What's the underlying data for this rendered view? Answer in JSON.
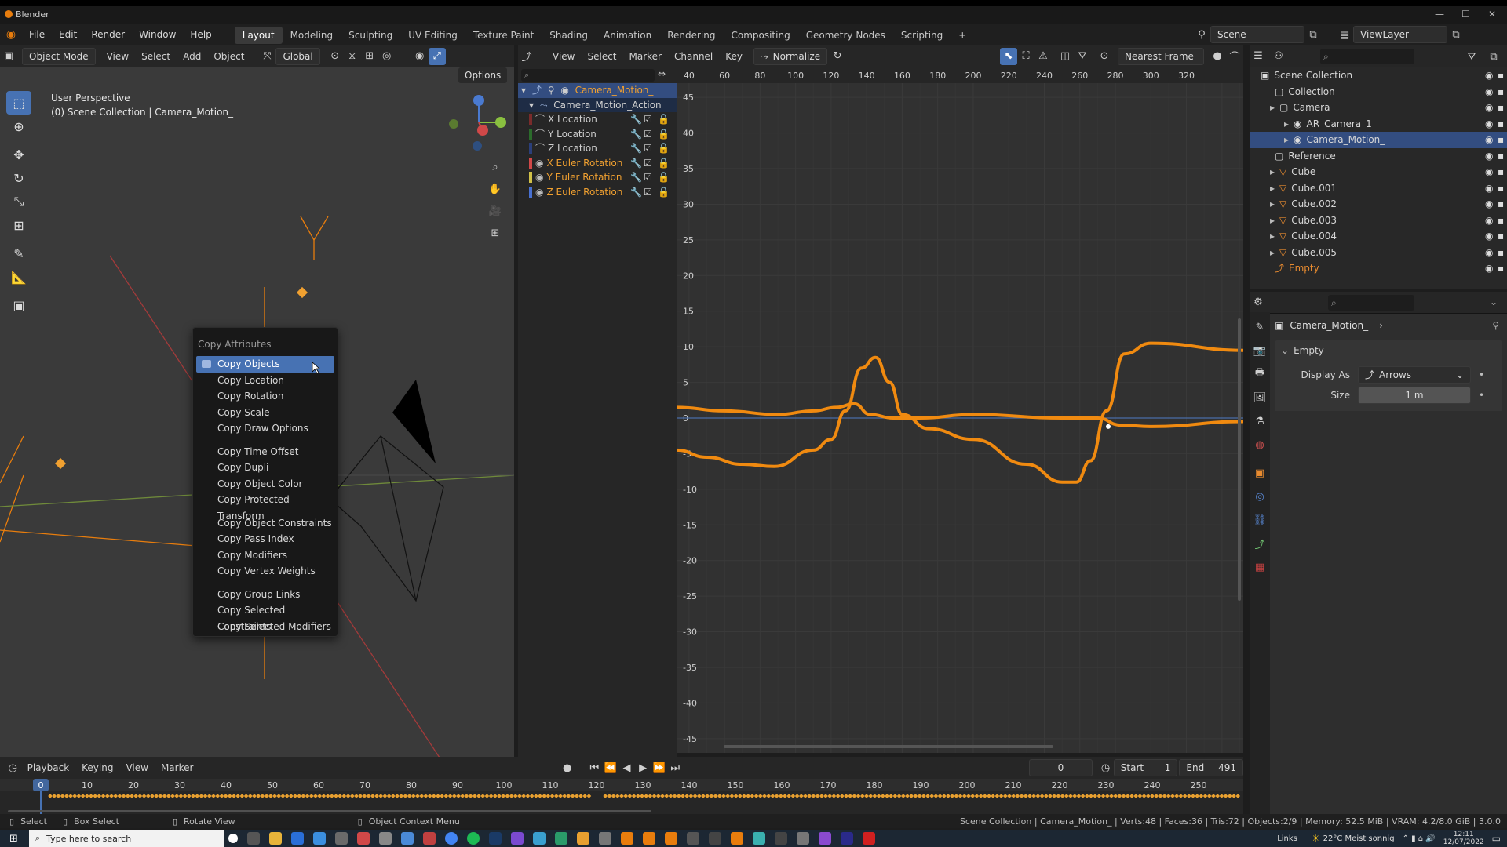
{
  "window": {
    "title": "Blender"
  },
  "menu": [
    "File",
    "Edit",
    "Render",
    "Window",
    "Help"
  ],
  "workspaces": [
    "Layout",
    "Modeling",
    "Sculpting",
    "UV Editing",
    "Texture Paint",
    "Shading",
    "Animation",
    "Rendering",
    "Compositing",
    "Geometry Nodes",
    "Scripting"
  ],
  "workspace_add": "+",
  "scene": {
    "name": "Scene",
    "view_layer": "ViewLayer"
  },
  "viewport": {
    "mode": "Object Mode",
    "menus": [
      "View",
      "Select",
      "Add",
      "Object"
    ],
    "orientation": "Global",
    "options_label": "Options",
    "perspective": "User Perspective",
    "collection_label": "(0) Scene Collection | Camera_Motion_"
  },
  "context_menu": {
    "title": "Copy Attributes",
    "groups": [
      [
        "Copy Objects",
        "Copy Location",
        "Copy Rotation",
        "Copy Scale",
        "Copy Draw Options"
      ],
      [
        "Copy Time Offset",
        "Copy Dupli",
        "Copy Object Color",
        "Copy Protected Transform"
      ],
      [
        "Copy Object Constraints",
        "Copy Pass Index",
        "Copy Modifiers",
        "Copy Vertex Weights"
      ],
      [
        "Copy Group Links",
        "Copy Selected Constraints",
        "Copy Selected Modifiers"
      ]
    ],
    "highlighted": "Copy Objects"
  },
  "graph_editor": {
    "menus": [
      "View",
      "Select",
      "Marker",
      "Channel",
      "Key"
    ],
    "normalize_label": "Normalize",
    "snap_mode": "Nearest Frame",
    "object_channel": "Camera_Motion_",
    "action_channel": "Camera_Motion_Action",
    "channels": [
      {
        "name": "X Location",
        "color": "#7a2b2b",
        "visible": false
      },
      {
        "name": "Y Location",
        "color": "#2b6b2b",
        "visible": false
      },
      {
        "name": "Z Location",
        "color": "#2b3f7a",
        "visible": false
      },
      {
        "name": "X Euler Rotation",
        "color": "#d04848",
        "visible": true
      },
      {
        "name": "Y Euler Rotation",
        "color": "#d0c048",
        "visible": true
      },
      {
        "name": "Z Euler Rotation",
        "color": "#4870d0",
        "visible": true
      }
    ],
    "frame_ticks": [
      40,
      60,
      80,
      100,
      120,
      140,
      160,
      180,
      200,
      220,
      240,
      260,
      280,
      300,
      320
    ],
    "value_ticks": [
      45,
      40,
      35,
      30,
      25,
      20,
      15,
      10,
      5,
      0,
      -5,
      -10,
      -15,
      -20,
      -25,
      -30,
      -35,
      -40,
      -45
    ]
  },
  "chart_data": {
    "type": "line",
    "xlabel": "",
    "ylabel": "",
    "xlim": [
      33,
      352
    ],
    "ylim": [
      -47,
      47
    ],
    "grid": true,
    "series": [
      {
        "color": "#f08a10",
        "x": [
          33,
          60,
          90,
          110,
          123,
          133,
          142,
          155,
          170,
          200,
          250,
          270,
          283,
          300,
          352
        ],
        "values": [
          1.5,
          1.0,
          0.5,
          1.0,
          1.5,
          2.0,
          0.5,
          0,
          0,
          0.5,
          0,
          0,
          -1.0,
          -1.2,
          -0.5
        ]
      },
      {
        "color": "#f08a10",
        "x": [
          33,
          50,
          70,
          88,
          110,
          120,
          128,
          137,
          145,
          153,
          160,
          175,
          200,
          230,
          250,
          258,
          266,
          275,
          285,
          300,
          352
        ],
        "values": [
          -4.5,
          -5.5,
          -6.5,
          -6.8,
          -4.5,
          -3.0,
          1.0,
          7.0,
          8.5,
          5.0,
          0.5,
          -1.5,
          -3.0,
          -6.5,
          -9.0,
          -9.0,
          -6.0,
          1.0,
          9.0,
          10.5,
          9.5
        ]
      }
    ]
  },
  "outliner": {
    "items": [
      {
        "name": "Scene Collection",
        "level": 0
      },
      {
        "name": "Collection",
        "level": 1
      },
      {
        "name": "Camera",
        "level": 1
      },
      {
        "name": "AR_Camera_1",
        "level": 2
      },
      {
        "name": "Camera_Motion_",
        "level": 2,
        "selected": true
      },
      {
        "name": "Reference",
        "level": 1
      },
      {
        "name": "Cube",
        "level": 1
      },
      {
        "name": "Cube.001",
        "level": 1
      },
      {
        "name": "Cube.002",
        "level": 1
      },
      {
        "name": "Cube.003",
        "level": 1
      },
      {
        "name": "Cube.004",
        "level": 1
      },
      {
        "name": "Cube.005",
        "level": 1
      },
      {
        "name": "Empty",
        "level": 1,
        "active": true
      }
    ]
  },
  "properties": {
    "object_name": "Camera_Motion_",
    "panel": "Empty",
    "display_as_label": "Display As",
    "display_as_value": "Arrows",
    "size_label": "Size",
    "size_value": "1 m"
  },
  "timeline": {
    "menus": [
      "Playback",
      "Keying",
      "View",
      "Marker"
    ],
    "current_frame": "0",
    "start_label": "Start",
    "start": "1",
    "end_label": "End",
    "end": "491",
    "ticks": [
      0,
      10,
      20,
      30,
      40,
      50,
      60,
      70,
      80,
      90,
      100,
      110,
      120,
      130,
      140,
      150,
      160,
      170,
      180,
      190,
      200,
      210,
      220,
      230,
      240,
      250
    ]
  },
  "status": {
    "select": "Select",
    "box_select": "Box Select",
    "rotate_view": "Rotate View",
    "context_menu": "Object Context Menu",
    "stats": "Scene Collection | Camera_Motion_ | Verts:48 | Faces:36 | Tris:72 | Objects:2/9 | Memory: 52.5 MiB | VRAM: 4.2/8.0 GiB | 3.0.0"
  },
  "taskbar": {
    "search_placeholder": "Type here to search",
    "links": "Links",
    "weather": "22°C  Meist sonnig",
    "time": "12:11",
    "date": "12/07/2022"
  }
}
